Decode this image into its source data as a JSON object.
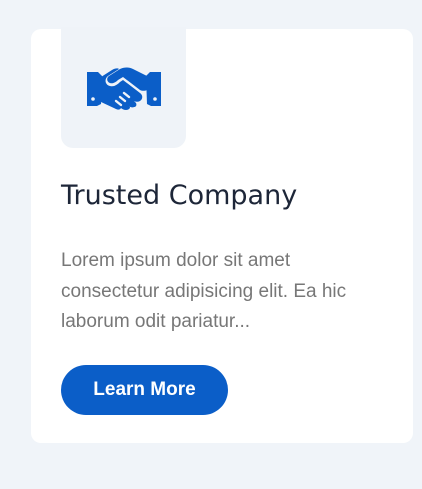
{
  "card": {
    "icon": "handshake-icon",
    "title": "Trusted Company",
    "description": "Lorem ipsum dolor sit amet consectetur adipisicing elit. Ea hic laborum odit pariatur...",
    "button_label": "Learn More"
  },
  "colors": {
    "page_background": "#f0f4f9",
    "card_background": "#ffffff",
    "icon_box_background": "#eff3f8",
    "accent": "#0b5ec8",
    "title_text": "#1d2638",
    "body_text": "#777777"
  }
}
